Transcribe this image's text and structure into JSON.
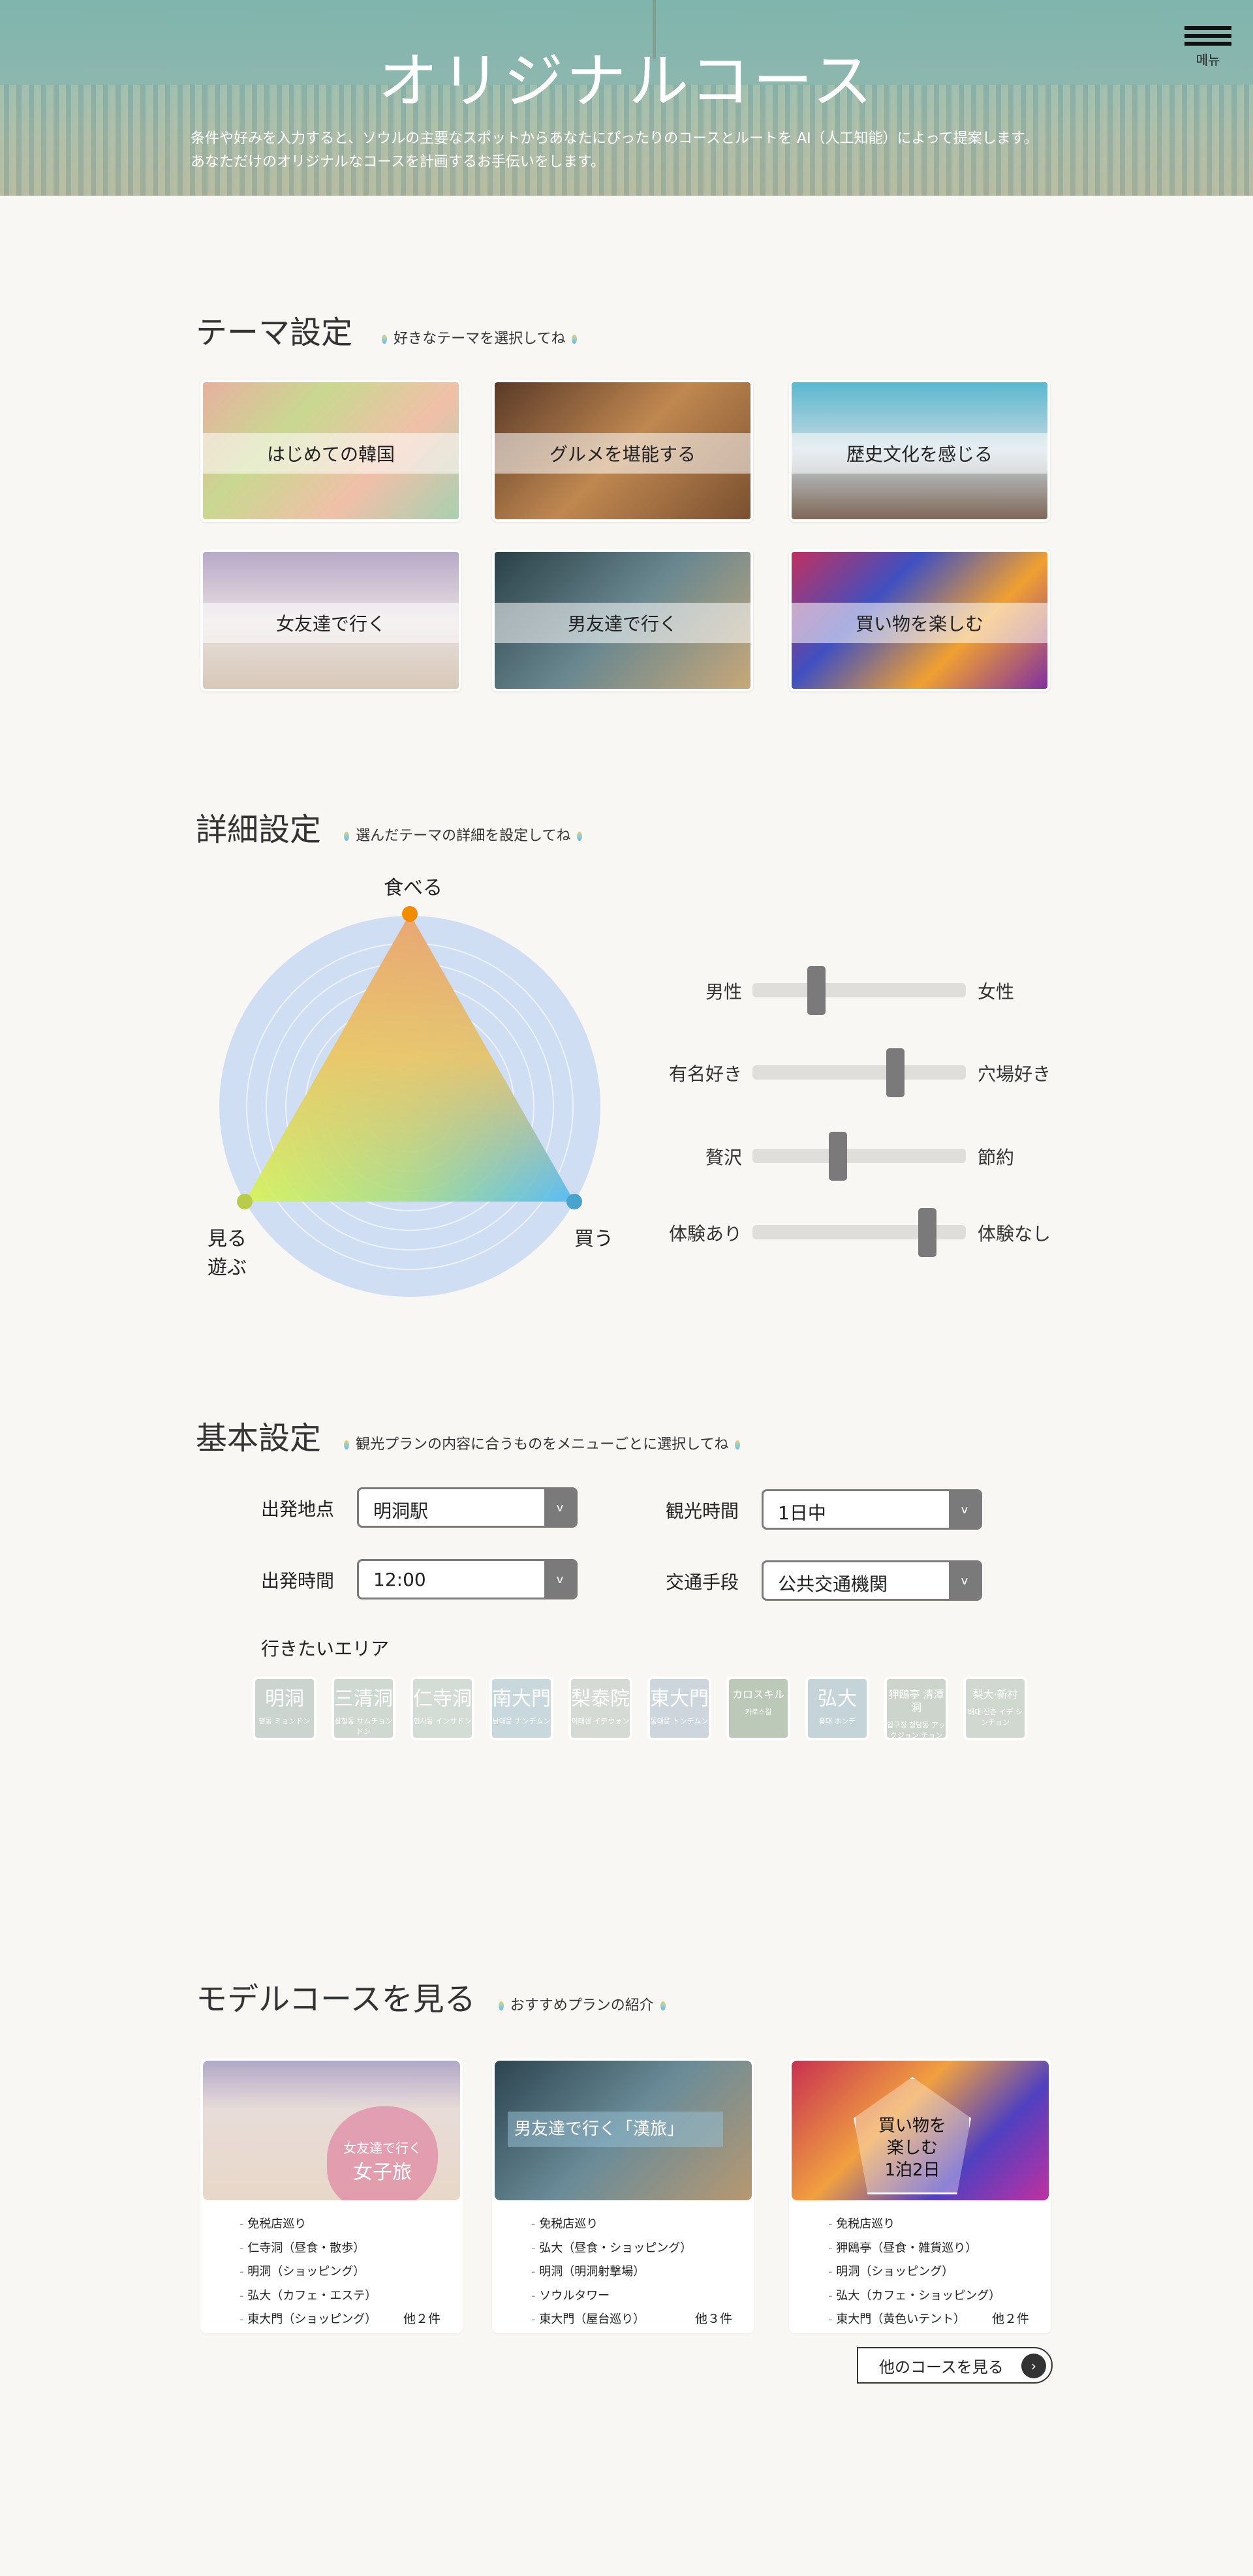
{
  "header": {
    "title": "オリジナルコース",
    "desc_line1": "条件や好みを入力すると、ソウルの主要なスポットからあなたにぴったりのコースとルートを AI（人工知能）によって提案します。",
    "desc_line2": "あなただけのオリジナルなコースを計画するお手伝いをします。",
    "menu_label": "메뉴"
  },
  "theme": {
    "title": "テーマ設定",
    "subtitle": "好きなテーマを選択してね",
    "cards": [
      {
        "label": "はじめての韓国"
      },
      {
        "label": "グルメを堪能する"
      },
      {
        "label": "歴史文化を感じる"
      },
      {
        "label": "女友達で行く"
      },
      {
        "label": "男友達で行く"
      },
      {
        "label": "買い物を楽しむ"
      }
    ]
  },
  "detail": {
    "title": "詳細設定",
    "subtitle": "選んだテーマの詳細を設定してね",
    "radar": {
      "top": "食べる",
      "left_line1": "見る",
      "left_line2": "遊ぶ",
      "right": "買う",
      "colors": {
        "top": "#f28c00",
        "left": "#b8cc4a",
        "right": "#4aa3cc"
      }
    },
    "sliders": [
      {
        "left": "男性",
        "right": "女性",
        "value": 0.3
      },
      {
        "left": "有名好き",
        "right": "穴場好き",
        "value": 0.67
      },
      {
        "left": "贅沢",
        "right": "節約",
        "value": 0.4
      },
      {
        "left": "体験あり",
        "right": "体験なし",
        "value": 0.82
      }
    ]
  },
  "basic": {
    "title": "基本設定",
    "subtitle": "観光プランの内容に合うものをメニューごとに選択してね",
    "selects": [
      {
        "label": "出発地点",
        "value": "明洞駅"
      },
      {
        "label": "観光時間",
        "value": "1日中"
      },
      {
        "label": "出発時間",
        "value": "12:00"
      },
      {
        "label": "交通手段",
        "value": "公共交通機関"
      }
    ],
    "area_label": "行きたいエリア",
    "areas": [
      {
        "name": "明洞",
        "sub": "명동 ミョンドン"
      },
      {
        "name": "三清洞",
        "sub": "삼청동 サムチョンドン"
      },
      {
        "name": "仁寺洞",
        "sub": "인사동 インサドン"
      },
      {
        "name": "南大門",
        "sub": "남대문 ナンデムン"
      },
      {
        "name": "梨泰院",
        "sub": "이태원 イテウォン"
      },
      {
        "name": "東大門",
        "sub": "동대문 トンデムン"
      },
      {
        "name": "カロスキル",
        "sub": "카로스길"
      },
      {
        "name": "弘大",
        "sub": "홍대 ホンデ"
      },
      {
        "name": "狎鴎亭 清潭洞",
        "sub": "압구정·청담동 アックジョン チョンダムドン"
      },
      {
        "name": "梨大·新村",
        "sub": "배대·신촌 イデ シンチョン"
      }
    ]
  },
  "model": {
    "title": "モデルコースを見る",
    "subtitle": "おすすめプランの紹介",
    "courses": [
      {
        "overlay_line1": "女友達で行く",
        "overlay_line2": "女子旅",
        "items": [
          "免税店巡り",
          "仁寺洞（昼食・散歩）",
          "明洞（ショッピング）",
          "弘大（カフェ・エステ）",
          "東大門（ショッピング）"
        ],
        "more": "他２件"
      },
      {
        "overlay_line1": "男友達で行く「漢旅」",
        "overlay_line2": "",
        "items": [
          "免税店巡り",
          "弘大（昼食・ショッピング）",
          "明洞（明洞射撃場）",
          "ソウルタワー",
          "東大門（屋台巡り）"
        ],
        "more": "他３件"
      },
      {
        "overlay_line1": "買い物を楽しむ",
        "overlay_line2": "1泊2日",
        "items": [
          "免税店巡り",
          "狎鴎亭（昼食・雑貨巡り）",
          "明洞（ショッピング）",
          "弘大（カフェ・ショッピング）",
          "東大門（黄色いテント）"
        ],
        "more": "他２件"
      }
    ],
    "more_button": "他のコースを見る"
  }
}
